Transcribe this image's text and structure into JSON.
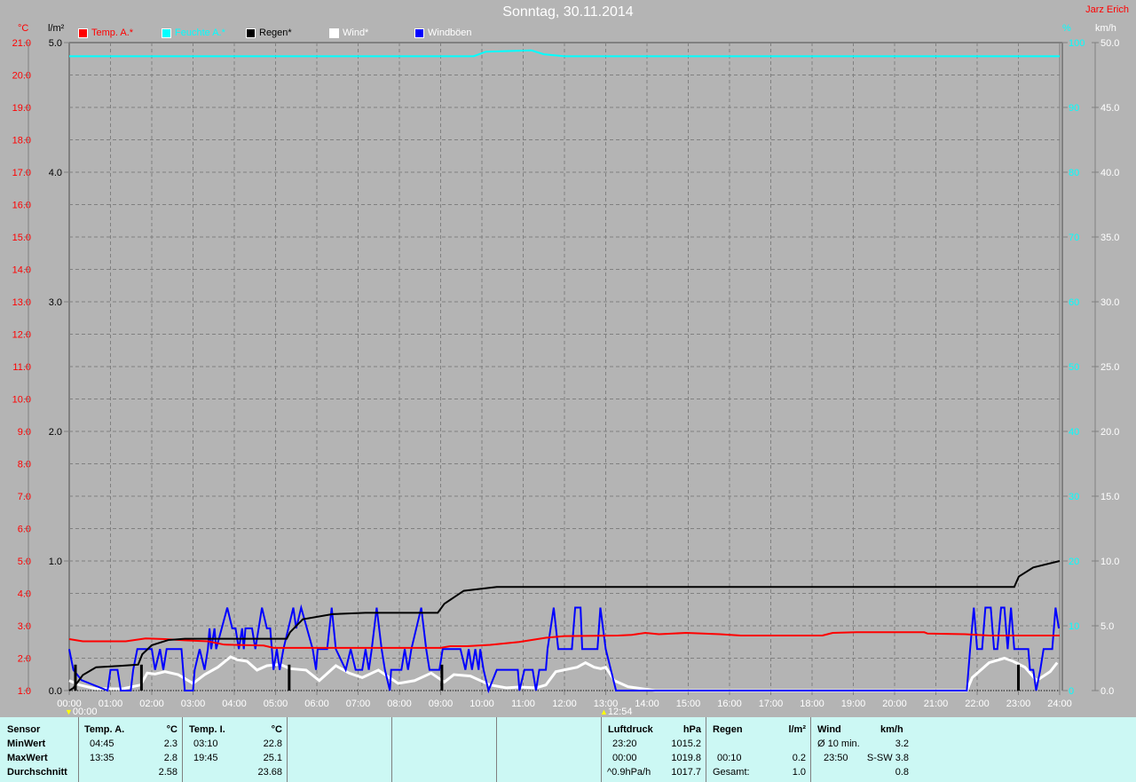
{
  "header": {
    "title": "Sonntag, 30.11.2014",
    "author": "Jarz Erich"
  },
  "legend": [
    {
      "label": "Temp. A.*",
      "color": "#ff0000"
    },
    {
      "label": "Feuchte A.*",
      "color": "#00ffff"
    },
    {
      "label": "Regen*",
      "color": "#000000"
    },
    {
      "label": "Wind*",
      "color": "#ffffff"
    },
    {
      "label": "Windböen",
      "color": "#0000ff"
    }
  ],
  "markers": [
    {
      "time": "00:00",
      "icon": "moon-icon",
      "hour": 0
    },
    {
      "time": "12:54",
      "icon": "sun-icon",
      "hour": 13
    }
  ],
  "chart_data": {
    "type": "line",
    "grid": true,
    "legend_position": "top",
    "x": {
      "label": "",
      "range": [
        "00:00",
        "24:00"
      ],
      "ticks": [
        "00:00",
        "01:00",
        "02:00",
        "03:00",
        "04:00",
        "05:00",
        "06:00",
        "07:00",
        "08:00",
        "09:00",
        "10:00",
        "11:00",
        "12:00",
        "13:00",
        "14:00",
        "15:00",
        "16:00",
        "17:00",
        "18:00",
        "19:00",
        "20:00",
        "21:00",
        "22:00",
        "23:00",
        "24:00"
      ]
    },
    "axes": {
      "temp": {
        "unit": "°C",
        "range": [
          1.0,
          21.0
        ],
        "step": 1.0,
        "color": "#ff0000"
      },
      "rain": {
        "unit": "l/m²",
        "range": [
          0.0,
          5.0
        ],
        "step": 1.0,
        "color": "#000000"
      },
      "humidity": {
        "unit": "%",
        "range": [
          0,
          100
        ],
        "step": 10,
        "color": "#00ffff"
      },
      "wind": {
        "unit": "km/h",
        "range": [
          0.0,
          50.0
        ],
        "step": 5.0,
        "color": "#ffffff"
      }
    },
    "series": [
      {
        "name": "Temp. A.*",
        "axis": "temp",
        "color": "#ff0000",
        "points": [
          [
            0,
            2.59
          ],
          [
            0.33,
            2.52
          ],
          [
            1.37,
            2.52
          ],
          [
            1.85,
            2.61
          ],
          [
            2.32,
            2.59
          ],
          [
            2.8,
            2.55
          ],
          [
            3.36,
            2.52
          ],
          [
            3.75,
            2.42
          ],
          [
            4.71,
            2.39
          ],
          [
            4.95,
            2.32
          ],
          [
            9.0,
            2.32
          ],
          [
            9.23,
            2.37
          ],
          [
            9.64,
            2.37
          ],
          [
            10.2,
            2.41
          ],
          [
            10.9,
            2.5
          ],
          [
            11.55,
            2.63
          ],
          [
            12.0,
            2.68
          ],
          [
            13.3,
            2.7
          ],
          [
            13.63,
            2.72
          ],
          [
            13.96,
            2.78
          ],
          [
            14.29,
            2.74
          ],
          [
            14.95,
            2.78
          ],
          [
            15.77,
            2.74
          ],
          [
            16.27,
            2.7
          ],
          [
            18.25,
            2.7
          ],
          [
            18.5,
            2.78
          ],
          [
            19.07,
            2.8
          ],
          [
            20.72,
            2.8
          ],
          [
            20.8,
            2.76
          ],
          [
            21.71,
            2.74
          ],
          [
            22.29,
            2.7
          ],
          [
            24,
            2.7
          ]
        ]
      },
      {
        "name": "Feuchte A.*",
        "axis": "humidity",
        "color": "#00ffff",
        "points": [
          [
            0,
            97.9
          ],
          [
            9.8,
            97.9
          ],
          [
            10.1,
            98.6
          ],
          [
            11.2,
            98.8
          ],
          [
            11.5,
            98.2
          ],
          [
            12.0,
            97.9
          ],
          [
            24,
            97.9
          ]
        ]
      },
      {
        "name": "Regen*",
        "axis": "rain",
        "color": "#000000",
        "points": [
          [
            0,
            0
          ],
          [
            0.1,
            0.02
          ],
          [
            0.33,
            0.12
          ],
          [
            0.65,
            0.18
          ],
          [
            1.21,
            0.19
          ],
          [
            1.67,
            0.2
          ],
          [
            1.77,
            0.28
          ],
          [
            2.0,
            0.35
          ],
          [
            2.4,
            0.39
          ],
          [
            2.8,
            0.4
          ],
          [
            5.27,
            0.4
          ],
          [
            5.35,
            0.45
          ],
          [
            5.66,
            0.55
          ],
          [
            6.38,
            0.59
          ],
          [
            7.18,
            0.6
          ],
          [
            8.93,
            0.6
          ],
          [
            9.09,
            0.67
          ],
          [
            9.56,
            0.77
          ],
          [
            10.36,
            0.8
          ],
          [
            22.9,
            0.8
          ],
          [
            23.01,
            0.88
          ],
          [
            23.36,
            0.95
          ],
          [
            24,
            1.0
          ]
        ],
        "bars": [
          [
            0.15,
            0.2
          ],
          [
            1.75,
            0.2
          ],
          [
            5.33,
            0.2
          ],
          [
            9.03,
            0.2
          ],
          [
            23.0,
            0.2
          ]
        ]
      },
      {
        "name": "Wind*",
        "axis": "wind",
        "color": "#ffffff",
        "points": [
          [
            0,
            0.77
          ],
          [
            0.25,
            0.43
          ],
          [
            0.65,
            0.14
          ],
          [
            1.29,
            0.14
          ],
          [
            1.73,
            0.43
          ],
          [
            1.89,
            1.35
          ],
          [
            2.08,
            1.28
          ],
          [
            2.32,
            1.46
          ],
          [
            2.64,
            1.23
          ],
          [
            3.0,
            0.55
          ],
          [
            3.28,
            1.23
          ],
          [
            3.6,
            1.8
          ],
          [
            3.91,
            2.6
          ],
          [
            4.07,
            2.38
          ],
          [
            4.31,
            2.26
          ],
          [
            4.55,
            1.58
          ],
          [
            4.79,
            1.92
          ],
          [
            5.11,
            2.03
          ],
          [
            5.35,
            1.69
          ],
          [
            5.74,
            1.58
          ],
          [
            6.06,
            0.77
          ],
          [
            6.46,
            1.92
          ],
          [
            6.78,
            1.35
          ],
          [
            7.1,
            1.0
          ],
          [
            7.49,
            1.58
          ],
          [
            7.97,
            0.55
          ],
          [
            8.37,
            0.77
          ],
          [
            8.77,
            1.35
          ],
          [
            9.09,
            0.66
          ],
          [
            9.32,
            1.23
          ],
          [
            9.72,
            1.12
          ],
          [
            10.2,
            0.43
          ],
          [
            10.6,
            0.21
          ],
          [
            10.91,
            0.27
          ],
          [
            11.31,
            0.21
          ],
          [
            11.55,
            0.43
          ],
          [
            11.79,
            1.46
          ],
          [
            12.31,
            1.8
          ],
          [
            12.51,
            2.15
          ],
          [
            12.72,
            1.8
          ],
          [
            12.88,
            1.69
          ],
          [
            13.0,
            1.8
          ],
          [
            13.21,
            0.77
          ],
          [
            13.54,
            0.3
          ],
          [
            14.2,
            0
          ],
          [
            21.75,
            0
          ],
          [
            21.88,
            1.0
          ],
          [
            22.29,
            2.15
          ],
          [
            22.66,
            2.5
          ],
          [
            22.87,
            2.26
          ],
          [
            23.16,
            1.8
          ],
          [
            23.44,
            0.77
          ],
          [
            23.77,
            1.46
          ],
          [
            23.94,
            2.15
          ]
        ]
      },
      {
        "name": "Windböen",
        "axis": "wind",
        "color": "#0000ff",
        "step": true,
        "points": [
          [
            0,
            3.2
          ],
          [
            0.1,
            1.6
          ],
          [
            0.3,
            0.8
          ],
          [
            0.93,
            0
          ],
          [
            1.0,
            1.6
          ],
          [
            1.17,
            1.6
          ],
          [
            1.25,
            0
          ],
          [
            1.49,
            0
          ],
          [
            1.55,
            1.6
          ],
          [
            1.65,
            3.2
          ],
          [
            2.0,
            3.2
          ],
          [
            2.08,
            1.6
          ],
          [
            2.2,
            3.2
          ],
          [
            2.28,
            1.6
          ],
          [
            2.36,
            3.2
          ],
          [
            2.72,
            3.2
          ],
          [
            2.8,
            0
          ],
          [
            3.0,
            0
          ],
          [
            3.04,
            1.6
          ],
          [
            3.16,
            3.2
          ],
          [
            3.28,
            1.6
          ],
          [
            3.36,
            3.2
          ],
          [
            3.4,
            4.8
          ],
          [
            3.44,
            3.2
          ],
          [
            3.52,
            4.8
          ],
          [
            3.56,
            3.2
          ],
          [
            3.83,
            6.4
          ],
          [
            3.95,
            4.8
          ],
          [
            4.03,
            4.8
          ],
          [
            4.11,
            3.2
          ],
          [
            4.19,
            4.8
          ],
          [
            4.23,
            3.2
          ],
          [
            4.27,
            4.8
          ],
          [
            4.43,
            4.8
          ],
          [
            4.51,
            3.2
          ],
          [
            4.67,
            6.4
          ],
          [
            4.79,
            4.8
          ],
          [
            4.87,
            4.8
          ],
          [
            4.95,
            1.6
          ],
          [
            5.03,
            3.2
          ],
          [
            5.1,
            1.6
          ],
          [
            5.19,
            3.2
          ],
          [
            5.43,
            6.4
          ],
          [
            5.5,
            4.8
          ],
          [
            5.62,
            6.4
          ],
          [
            5.9,
            3.2
          ],
          [
            5.98,
            1.6
          ],
          [
            6.02,
            3.2
          ],
          [
            6.25,
            3.2
          ],
          [
            6.36,
            6.4
          ],
          [
            6.46,
            3.2
          ],
          [
            6.7,
            1.6
          ],
          [
            6.82,
            3.2
          ],
          [
            6.94,
            1.6
          ],
          [
            7.1,
            1.6
          ],
          [
            7.18,
            3.2
          ],
          [
            7.26,
            1.6
          ],
          [
            7.33,
            3.2
          ],
          [
            7.45,
            6.4
          ],
          [
            7.57,
            3.2
          ],
          [
            7.65,
            1.6
          ],
          [
            7.77,
            0
          ],
          [
            7.8,
            1.6
          ],
          [
            8.05,
            1.6
          ],
          [
            8.13,
            3.2
          ],
          [
            8.21,
            1.6
          ],
          [
            8.29,
            3.2
          ],
          [
            8.53,
            6.4
          ],
          [
            8.65,
            3.2
          ],
          [
            8.73,
            1.6
          ],
          [
            8.97,
            1.6
          ],
          [
            9.05,
            3.2
          ],
          [
            9.48,
            3.2
          ],
          [
            9.6,
            1.6
          ],
          [
            9.68,
            3.2
          ],
          [
            9.76,
            1.6
          ],
          [
            9.84,
            3.2
          ],
          [
            9.92,
            1.6
          ],
          [
            9.96,
            3.2
          ],
          [
            10.04,
            1.6
          ],
          [
            10.16,
            0
          ],
          [
            10.36,
            1.6
          ],
          [
            10.87,
            1.6
          ],
          [
            10.91,
            0
          ],
          [
            11.03,
            1.6
          ],
          [
            11.23,
            1.6
          ],
          [
            11.31,
            0
          ],
          [
            11.39,
            1.6
          ],
          [
            11.55,
            1.6
          ],
          [
            11.59,
            3.2
          ],
          [
            11.74,
            6.4
          ],
          [
            11.85,
            3.2
          ],
          [
            12.18,
            3.2
          ],
          [
            12.26,
            6.4
          ],
          [
            12.39,
            6.4
          ],
          [
            12.43,
            3.2
          ],
          [
            12.8,
            3.2
          ],
          [
            12.87,
            6.4
          ],
          [
            13.0,
            3.2
          ],
          [
            13.25,
            0
          ],
          [
            21.75,
            0
          ],
          [
            21.83,
            3.2
          ],
          [
            21.92,
            6.4
          ],
          [
            22.0,
            3.2
          ],
          [
            22.12,
            3.2
          ],
          [
            22.2,
            6.4
          ],
          [
            22.33,
            6.4
          ],
          [
            22.41,
            3.2
          ],
          [
            22.49,
            3.2
          ],
          [
            22.58,
            6.4
          ],
          [
            22.66,
            6.4
          ],
          [
            22.74,
            3.2
          ],
          [
            22.82,
            6.4
          ],
          [
            22.9,
            3.2
          ],
          [
            23.24,
            3.2
          ],
          [
            23.28,
            1.6
          ],
          [
            23.36,
            1.6
          ],
          [
            23.43,
            0
          ],
          [
            23.53,
            1.6
          ],
          [
            23.61,
            3.2
          ],
          [
            23.82,
            3.2
          ],
          [
            23.9,
            6.4
          ],
          [
            23.98,
            4.8
          ]
        ]
      }
    ]
  },
  "table": {
    "rowlabels": {
      "header": "Sensor",
      "min": "MinWert",
      "max": "MaxWert",
      "avg": "Durchschnitt"
    },
    "temp_a": {
      "header": "Temp. A.",
      "unit": "°C",
      "min_time": "04:45",
      "min": "2.3",
      "max_time": "13:35",
      "max": "2.8",
      "avg": "2.58"
    },
    "temp_i": {
      "header": "Temp. I.",
      "unit": "°C",
      "min_time": "03:10",
      "min": "22.8",
      "max_time": "19:45",
      "max": "25.1",
      "avg": "23.68"
    },
    "pressure": {
      "header": "Luftdruck",
      "unit": "hPa",
      "min_time": "23:20",
      "min": "1015.2",
      "max_time": "00:00",
      "max": "1019.8",
      "trend": "^0.9hPa/h",
      "avg": "1017.7"
    },
    "rain": {
      "header": "Regen",
      "unit": "l/m²",
      "max_time": "00:10",
      "max": "0.2",
      "total_label": "Gesamt:",
      "total": "1.0"
    },
    "wind": {
      "header": "Wind",
      "unit": "km/h",
      "avg_label": "Ø 10 min.",
      "avg10": "3.2",
      "max_time": "23:50",
      "max": "S-SW 3.8",
      "avg": "0.8"
    }
  }
}
